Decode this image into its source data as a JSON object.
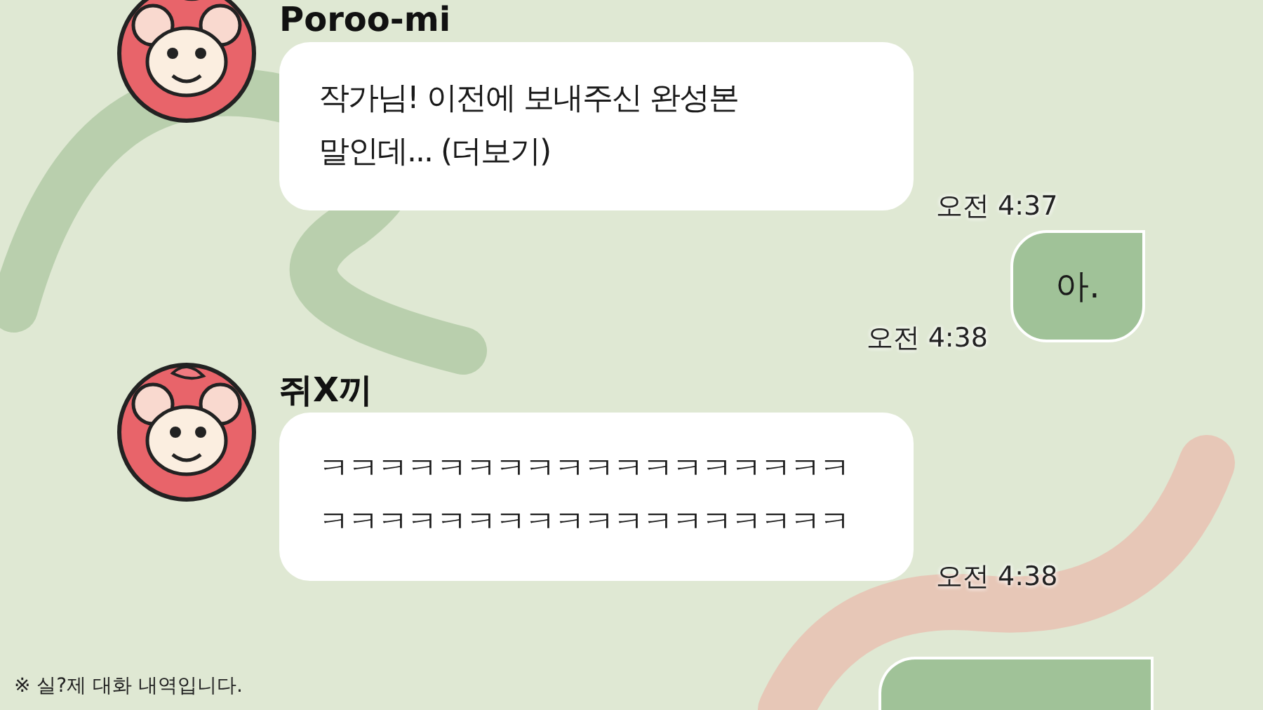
{
  "messages": [
    {
      "kind": "received",
      "sender": "Poroo-mi",
      "lines": [
        "작가님! 이전에 보내주신 완성본",
        "말인데... (더보기)"
      ],
      "time": "오전 4:37"
    },
    {
      "kind": "sent",
      "lines": [
        "아."
      ],
      "time": "오전 4:38"
    },
    {
      "kind": "received",
      "sender": "쥐X끼",
      "lines": [
        "ㅋㅋㅋㅋㅋㅋㅋㅋㅋㅋㅋㅋㅋㅋㅋㅋㅋㅋ",
        "ㅋㅋㅋㅋㅋㅋㅋㅋㅋㅋㅋㅋㅋㅋㅋㅋㅋㅋ"
      ],
      "time": "오전 4:38"
    }
  ],
  "footnote": "※ 실?제 대화 내역입니다.",
  "cut_bubble": {
    "kind": "sent"
  }
}
